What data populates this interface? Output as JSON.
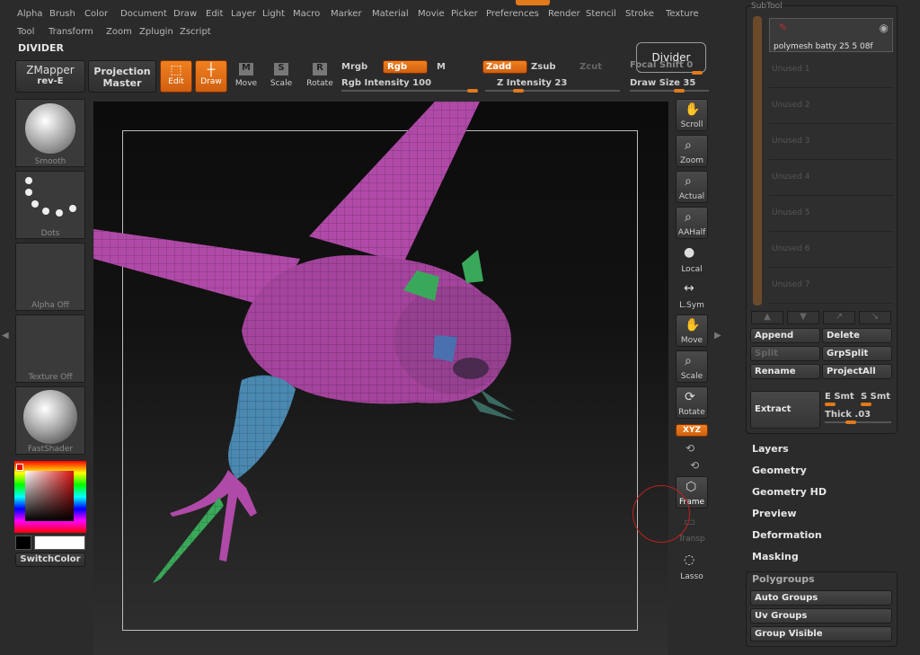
{
  "menu_row1": [
    "Alpha",
    "Brush",
    "Color",
    "Document",
    "Draw",
    "Edit",
    "Layer",
    "Light",
    "Macro",
    "Marker",
    "Material",
    "Movie",
    "Picker",
    "Preferences",
    "Render",
    "Stencil",
    "Stroke",
    "Texture"
  ],
  "menu_row2": [
    "Tool",
    "Transform",
    "Zoom",
    "Zplugin",
    "Zscript"
  ],
  "palette_title": "DIVIDER",
  "tooltip": "Divider",
  "toolbar": {
    "zmapper": "ZMapper",
    "zmapper_sub": "rev-E",
    "projection": "Projection",
    "projection_sub": "Master",
    "edit": "Edit",
    "draw": "Draw",
    "move": "Move",
    "scale": "Scale",
    "rotate": "Rotate",
    "mrgb": "Mrgb",
    "rgb": "Rgb",
    "m": "M",
    "zadd": "Zadd",
    "zsub": "Zsub",
    "zcut": "Zcut",
    "focal_shift": "Focal Shift 0",
    "rgb_intensity": "Rgb Intensity 100",
    "z_intensity": "Z Intensity 23",
    "draw_size": "Draw Size 35",
    "icon_m": "M",
    "icon_s": "S",
    "icon_r": "R"
  },
  "left_tiles": [
    "Smooth",
    "Dots",
    "Alpha Off",
    "Texture Off",
    "FastShader"
  ],
  "switch_color": "SwitchColor",
  "right_tools": [
    "Scroll",
    "Zoom",
    "Actual",
    "AAHalf",
    "Local",
    "L.Sym",
    "Move",
    "Scale",
    "Rotate",
    "XYZ",
    "Frame",
    "Transp",
    "Lasso"
  ],
  "subtool": {
    "header": "SubTool",
    "active": "polymesh batty 25 5 08f",
    "unused": [
      "Unused 1",
      "Unused 2",
      "Unused 3",
      "Unused 4",
      "Unused 5",
      "Unused 6",
      "Unused 7"
    ]
  },
  "subtool_buttons": {
    "append": "Append",
    "delete": "Delete",
    "split": "Split",
    "grpsplit": "GrpSplit",
    "rename": "Rename",
    "projectall": "ProjectAll",
    "extract": "Extract",
    "e_smt": "E Smt",
    "s_smt": "S Smt",
    "thick": "Thick .03"
  },
  "sections": [
    "Layers",
    "Geometry",
    "Geometry HD",
    "Preview",
    "Deformation",
    "Masking"
  ],
  "polygroups": {
    "header": "Polygroups",
    "buttons": [
      "Auto Groups",
      "Uv Groups",
      "Group Visible"
    ]
  },
  "colors": {
    "accent": "#e07a1c",
    "mesh_pink": "#b04aa8",
    "mesh_blue": "#4a88b0",
    "mesh_green": "#3aa85a"
  }
}
